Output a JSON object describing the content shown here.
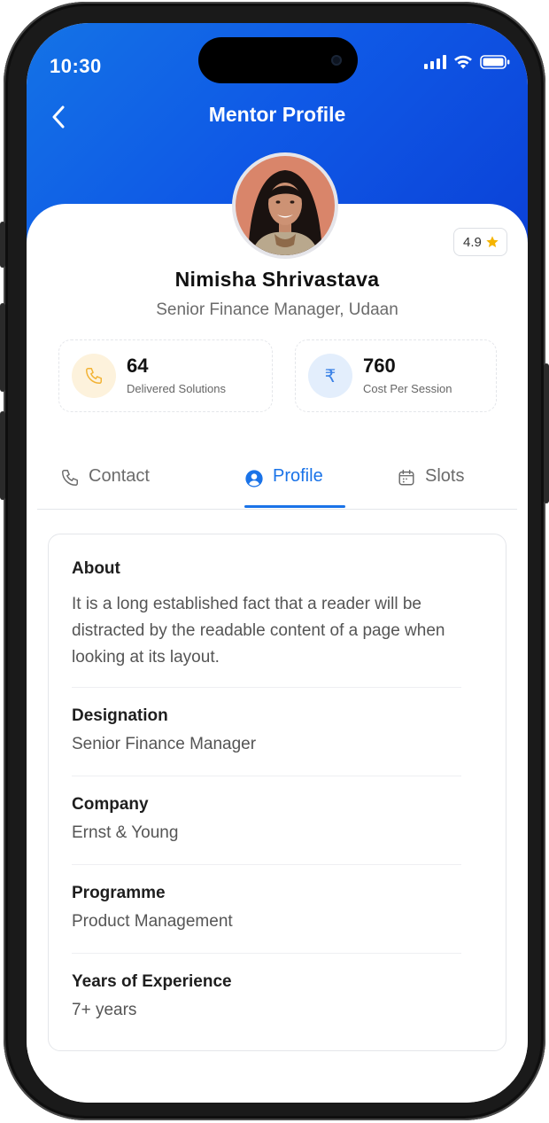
{
  "status_bar": {
    "time": "10:30"
  },
  "header": {
    "title": "Mentor Profile"
  },
  "mentor": {
    "name": "Nimisha Shrivastava",
    "title": "Senior Finance Manager, Udaan",
    "rating": "4.9"
  },
  "stats": [
    {
      "value": "64",
      "label": "Delivered Solutions",
      "icon": "phone-icon"
    },
    {
      "value": "760",
      "label": "Cost Per Session",
      "icon": "rupee-icon",
      "glyph": "₹"
    }
  ],
  "tabs": [
    {
      "label": "Contact",
      "icon": "phone-icon",
      "active": false
    },
    {
      "label": "Profile",
      "icon": "user-circle-icon",
      "active": true
    },
    {
      "label": "Slots",
      "icon": "calendar-icon",
      "active": false
    }
  ],
  "profile": {
    "about_heading": "About",
    "about_text": "It is a long established fact that a reader will be distracted by the readable content of a page when looking at its layout.",
    "designation_heading": "Designation",
    "designation_value": "Senior Finance Manager",
    "company_heading": "Company",
    "company_value": "Ernst & Young",
    "programme_heading": "Programme",
    "programme_value": "Product Management",
    "experience_heading": "Years of Experience",
    "experience_value": "7+ years"
  },
  "colors": {
    "header_gradient_start": "#1473e6",
    "header_gradient_end": "#0b3fd6",
    "accent": "#1a73e8",
    "star": "#f5b400",
    "stat_phone_bg": "#fdf2dc",
    "stat_rupee_bg": "#e3eefc"
  }
}
